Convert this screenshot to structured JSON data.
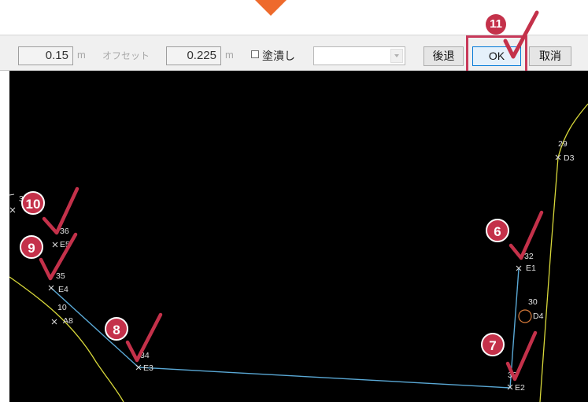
{
  "toolbar": {
    "width_value": "0.15",
    "width_unit": "m",
    "offset_label": "オフセット",
    "offset_value": "0.225",
    "offset_unit": "m",
    "fill_label": "塗潰し",
    "select_value": "",
    "back_label": "後退",
    "ok_label": "OK",
    "cancel_label": "取消"
  },
  "colors": {
    "accent_arrow": "#ee6a2c",
    "highlight": "#c8395a",
    "badge": "#c4314a",
    "polyline": "#5aa9d6",
    "boundary": "#d8d83a",
    "marker": "#d8d8d8"
  },
  "points": [
    {
      "number": "36",
      "name": "E5"
    },
    {
      "number": "35",
      "name": "E4"
    },
    {
      "number": "10",
      "name": "A8"
    },
    {
      "number": "34",
      "name": "E3"
    },
    {
      "number": "33",
      "name": "E2"
    },
    {
      "number": "32",
      "name": "E1"
    },
    {
      "number": "30",
      "name": "D4"
    },
    {
      "number": "29",
      "name": "D3"
    },
    {
      "number": "3"
    }
  ],
  "steps": [
    "6",
    "7",
    "8",
    "9",
    "10",
    "11"
  ]
}
